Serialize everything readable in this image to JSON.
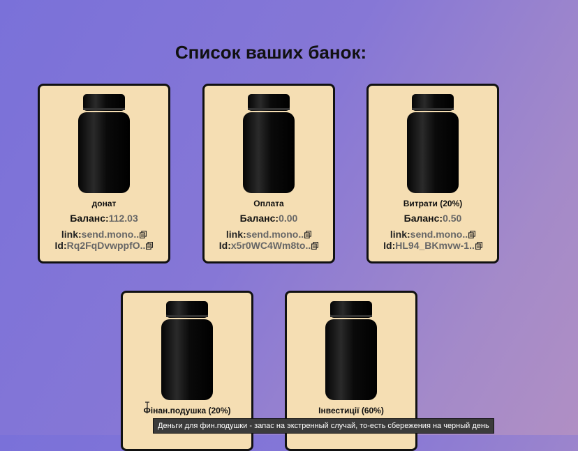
{
  "page": {
    "title": "Список ваших банок:"
  },
  "labels": {
    "balance": "Баланс:",
    "link": "link:",
    "id": "Id:"
  },
  "cards": [
    {
      "name": "донат",
      "balance": "112.03",
      "link": "send.mono..",
      "id": "Rq2FqDvwppfO.."
    },
    {
      "name": "Оплата",
      "balance": "0.00",
      "link": "send.mono..",
      "id": "x5r0WC4Wm8to.."
    },
    {
      "name": "Витрати (20%)",
      "balance": "0.50",
      "link": "send.mono..",
      "id": "HL94_BKmvw-1.."
    },
    {
      "name": "Фінан.подушка (20%)"
    },
    {
      "name": "Інвестиції (60%)"
    }
  ],
  "tooltip": {
    "text": "Деньги для фин.подушки - запас на экстренный случай, то-есть сбережения на черный день"
  },
  "icons": {
    "copy": "copy-icon",
    "jar": "jar-icon"
  },
  "colors": {
    "card_bg": "#f5deb3",
    "value_gray": "#666666"
  }
}
